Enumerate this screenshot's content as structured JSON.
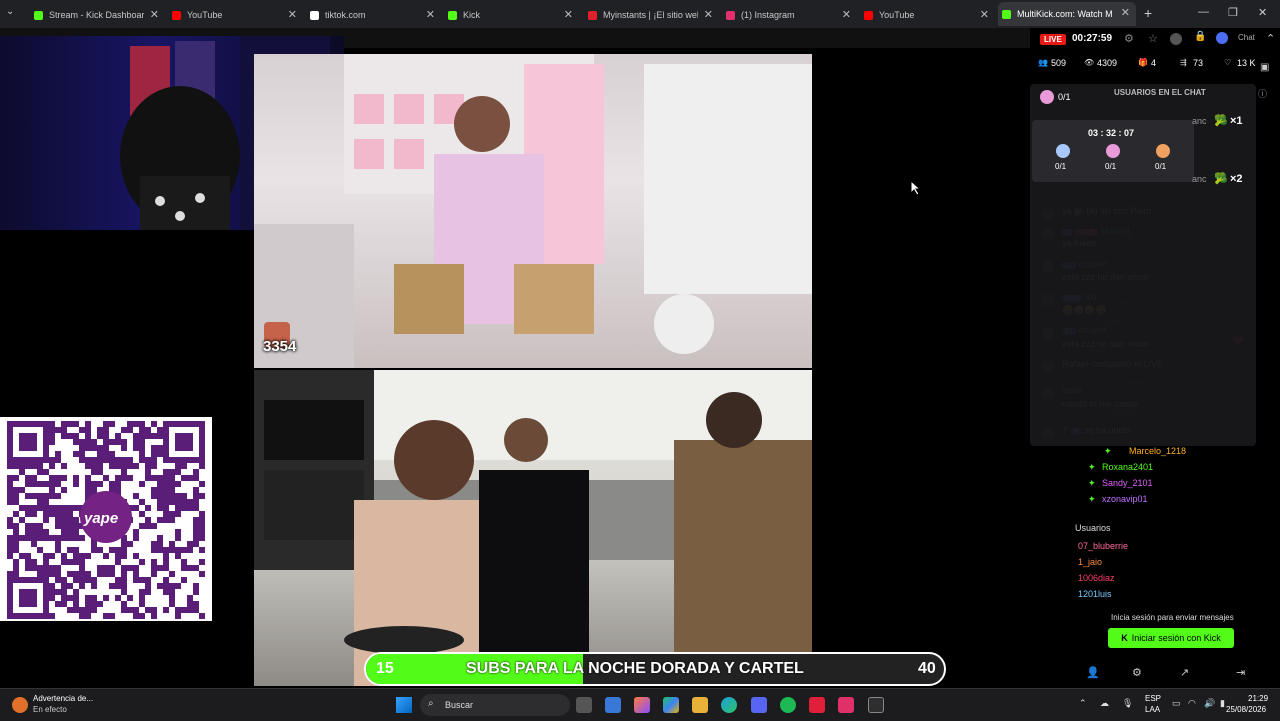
{
  "browser": {
    "tabs": [
      {
        "label": "Stream - Kick Dashboard",
        "favicon": "kick-icon",
        "color": "#53fc18"
      },
      {
        "label": "YouTube",
        "favicon": "youtube-icon",
        "color": "#ff0000"
      },
      {
        "label": "tiktok.com",
        "favicon": "tiktok-icon",
        "color": "#ffffff"
      },
      {
        "label": "Kick",
        "favicon": "kick-icon",
        "color": "#53fc18"
      },
      {
        "label": "Myinstants | ¡El sitio web de",
        "favicon": "myinstants-icon",
        "color": "#e0202a"
      },
      {
        "label": "(1) Instagram",
        "favicon": "instagram-icon",
        "color": "#e1306c"
      },
      {
        "label": "YouTube",
        "favicon": "youtube-icon",
        "color": "#ff0000"
      },
      {
        "label": "MultiKick.com: Watch M",
        "favicon": "multikick-icon",
        "color": "#53fc18"
      }
    ],
    "new_tab": "+"
  },
  "stream": {
    "overlay_counter": "3354",
    "sub_goal": {
      "current": "15",
      "target": "40",
      "text": "SUBS PARA LA NOCHE DORADA Y CARTEL",
      "fill_fraction": 0.375
    },
    "qr_brand": "yape",
    "cursor": "pointer-cursor"
  },
  "chat": {
    "live_label": "LIVE",
    "uptime": "00:27:59",
    "stats": [
      {
        "icon": "users-icon",
        "value": "509"
      },
      {
        "icon": "eye-icon",
        "value": "4309"
      },
      {
        "icon": "gift-icon",
        "value": "4"
      },
      {
        "icon": "share-icon",
        "value": "73"
      },
      {
        "icon": "heart-icon",
        "value": "13 K"
      }
    ],
    "users_in_chat_label": "USUARIOS EN EL CHAT",
    "popup": {
      "counter": "0/1",
      "timer": "03 : 32 : 07",
      "rewards": [
        "0/1",
        "0/1",
        "0/1"
      ],
      "combo1": "×1",
      "combo2": "×2",
      "partial_name": "anc"
    },
    "messages": [
      {
        "user": "",
        "badges": [],
        "text": "ya go tiki tiki con Piero",
        "color": "#ffffff"
      },
      {
        "user": "Marisol",
        "badges": [
          "1",
          "No. 3"
        ],
        "text": "ya fueee",
        "color": "#53fc18"
      },
      {
        "user": "cooper",
        "badges": [
          "17"
        ],
        "text": "esta zzz no dan show",
        "color": "#7ec8ff"
      },
      {
        "user": "aki",
        "badges": [
          "ZEN"
        ],
        "text": "😄😄😄😄",
        "color": "#cfcfcf"
      },
      {
        "user": "cooper",
        "badges": [
          "17"
        ],
        "text": "esta zzz no dan show",
        "color": "#7ec8ff"
      },
      {
        "user": "Rafael",
        "badges": [],
        "text": "compartió el LIVE",
        "color": "#ffffff"
      },
      {
        "user": "leslie",
        "badges": [],
        "text": "nando te me caiste",
        "color": "#7ec8ff"
      },
      {
        "user": "?",
        "badges": [
          "4"
        ],
        "text": "se ha unido",
        "color": "#ffffff"
      }
    ],
    "faded_users": [
      "jennn_20",
      "suscriptores",
      "03_geminis",
      "bely67",
      "Angelsakura",
      "katherinevsa",
      "lusme"
    ],
    "subscribers": [
      {
        "name": "Marcelo_1218",
        "color": "#ffb020"
      },
      {
        "name": "Roxana2401",
        "color": "#53fc18"
      },
      {
        "name": "Sandy_2101",
        "color": "#e060ff"
      },
      {
        "name": "xzonavip01",
        "color": "#c070ff"
      }
    ],
    "usuarios_label": "Usuarios",
    "usuarios": [
      {
        "name": "07_bluberrie",
        "color": "#ff6b9d"
      },
      {
        "name": "1_jaio",
        "color": "#ff8a3d"
      },
      {
        "name": "1006diaz",
        "color": "#ff3d6b"
      },
      {
        "name": "1201luis",
        "color": "#7ec8ff"
      }
    ],
    "login_prompt": "Inicia sesión para enviar mensajes",
    "login_button": "Iniciar sesión con Kick"
  },
  "taskbar": {
    "notification_title": "Advertencia de...",
    "notification_sub": "En efecto",
    "search_placeholder": "Buscar",
    "lang": "ESP",
    "lang_sub": "LAA",
    "time": "21:29",
    "date": "25/08/2026"
  }
}
